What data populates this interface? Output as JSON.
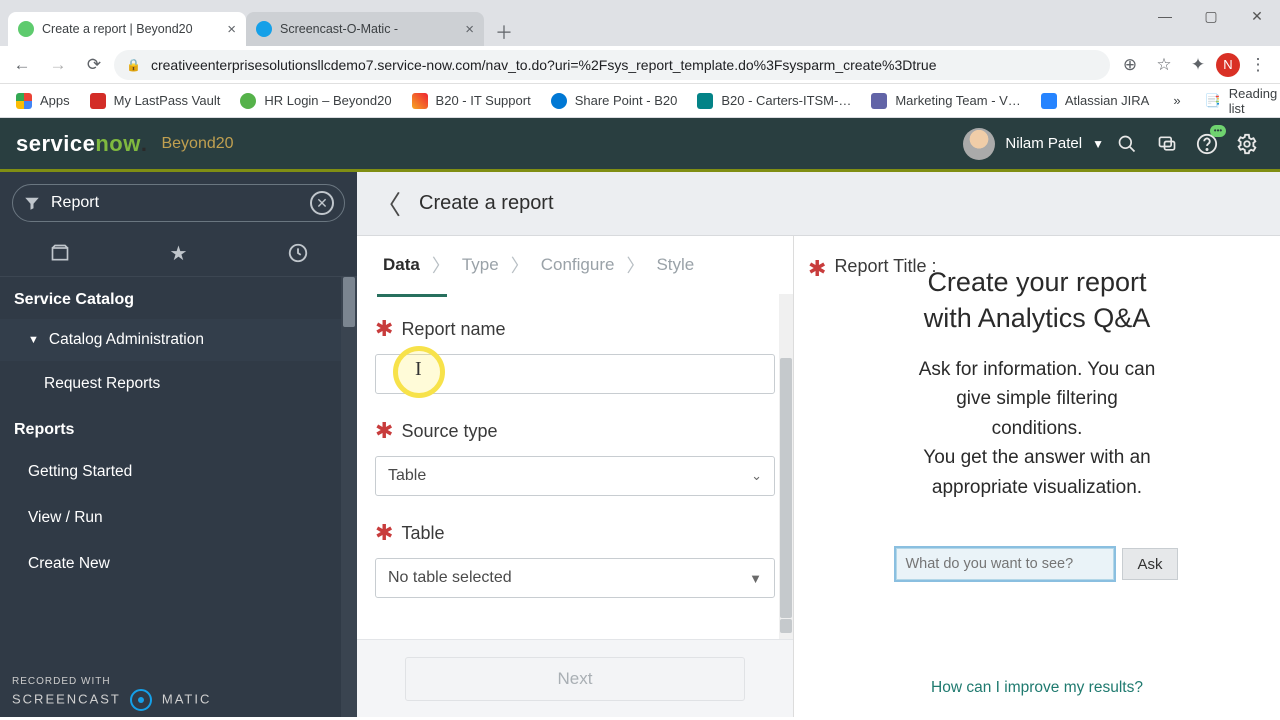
{
  "browser": {
    "tabs": [
      {
        "title": "Create a report | Beyond20",
        "active": true
      },
      {
        "title": "Screencast-O-Matic -",
        "active": false
      }
    ],
    "url": "creativeenterprisesolutionsllcdemo7.service-now.com/nav_to.do?uri=%2Fsys_report_template.do%3Fsysparm_create%3Dtrue",
    "profile_initial": "N",
    "bookmarks": {
      "apps": "Apps",
      "items": [
        "My LastPass Vault",
        "HR Login – Beyond20",
        "B20 - IT Support",
        "Share Point - B20",
        "B20 - Carters-ITSM-…",
        "Marketing Team - V…",
        "Atlassian JIRA"
      ],
      "overflow": "»",
      "reading_list": "Reading list"
    }
  },
  "banner": {
    "logo_a": "service",
    "logo_b": "now",
    "instance": "Beyond20",
    "user": "Nilam Patel"
  },
  "nav": {
    "filter_value": "Report",
    "sections": {
      "service_catalog": "Service Catalog",
      "catalog_admin": "Catalog Administration",
      "request_reports": "Request Reports",
      "reports": "Reports",
      "getting_started": "Getting Started",
      "view_run": "View / Run",
      "create_new": "Create New"
    }
  },
  "overlay": {
    "line1": "RECORDED WITH",
    "brand_a": "SCREENCAST",
    "brand_b": "MATIC"
  },
  "content": {
    "title": "Create a report",
    "wizard": {
      "data": "Data",
      "type": "Type",
      "configure": "Configure",
      "style": "Style"
    },
    "fields": {
      "report_name_label": "Report name",
      "report_name_value": "",
      "source_type_label": "Source type",
      "source_type_value": "Table",
      "table_label": "Table",
      "table_value": "No table selected"
    },
    "next_label": "Next"
  },
  "qa": {
    "report_title_label": "Report Title :",
    "heading_l1": "Create your report",
    "heading_l2": "with Analytics Q&A",
    "desc_l1": "Ask for information. You can",
    "desc_l2": "give simple filtering",
    "desc_l3": "conditions.",
    "desc_l4": "You get the answer with an",
    "desc_l5": "appropriate visualization.",
    "ask_placeholder": "What do you want to see?",
    "ask_btn": "Ask",
    "improve": "How can I improve my results?"
  }
}
